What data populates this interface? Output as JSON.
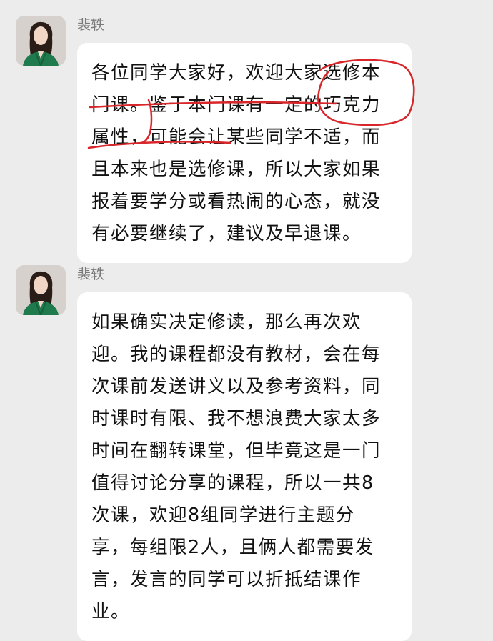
{
  "messages": [
    {
      "sender": "裴轶",
      "text": "各位同学大家好，欢迎大家选修本\n门课。鉴于本门课有一定的巧克力\n属性，可能会让某些同学不适，而\n且本来也是选修课，所以大家如果\n报着要学分或看热闹的心态，就没\n有必要继续了，建议及早退课。"
    },
    {
      "sender": "裴轶",
      "text": "如果确实决定修读，那么再次欢\n迎。我的课程都没有教材，会在每\n次课前发送讲义以及参考资料，同\n时课时有限、我不想浪费大家太多\n时间在翻转课堂，但毕竟这是一门\n值得讨论分享的课程，所以一共8\n次课，欢迎8组同学进行主题分\n享，每组限2人，且俩人都需要发\n言，发言的同学可以折抵结课作\n业。"
    }
  ],
  "colors": {
    "background": "#ececec",
    "bubble": "#ffffff",
    "annotation": "#d8262a",
    "avatar_jacket": "#1f7a4d"
  },
  "icons": {
    "avatar": "profile-photo-woman-green-jacket"
  }
}
